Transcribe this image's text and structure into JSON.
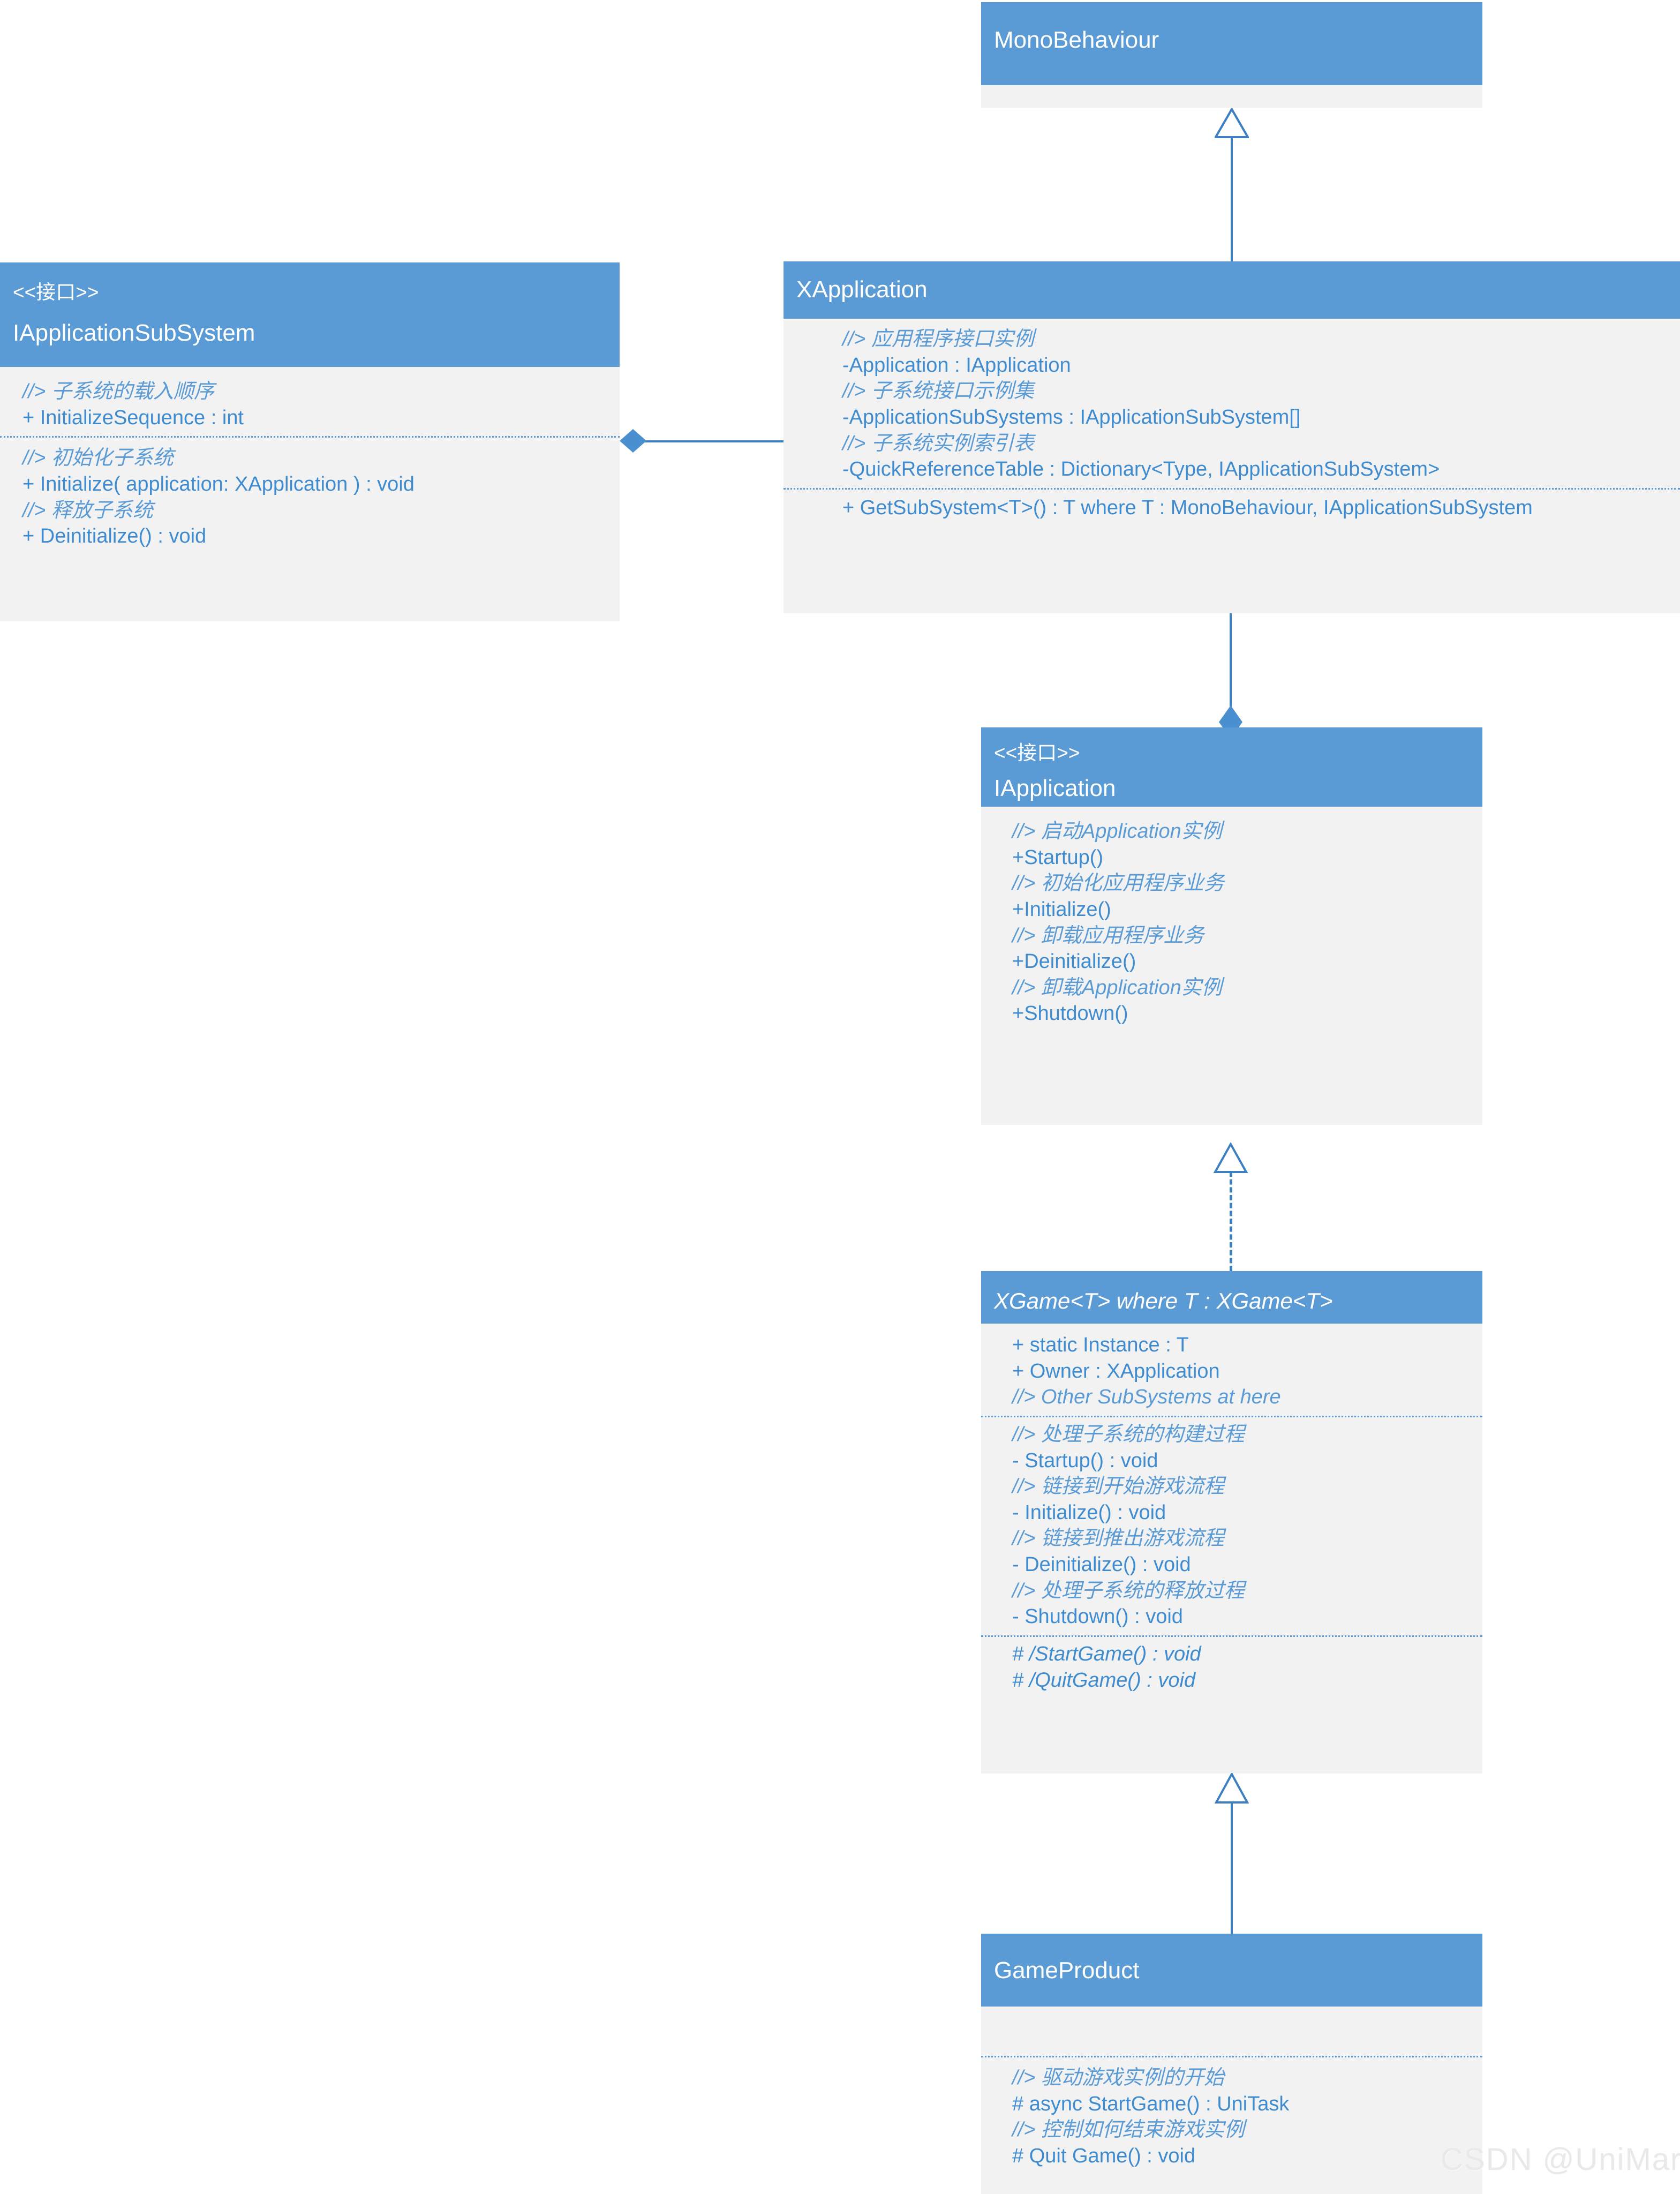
{
  "diagram": {
    "kind": "uml-class-diagram",
    "colors": {
      "header_fill": "#5b9bd5",
      "body_fill": "#f2f2f2",
      "member_text": "#3e8bd0",
      "connector": "#3e7fc1",
      "watermark": "#e9e9e9"
    }
  },
  "classes": {
    "monobehaviour": {
      "name": "MonoBehaviour",
      "stereotype": "",
      "compartments": []
    },
    "iapplicationsubsystem": {
      "stereotype": "<<接口>>",
      "name": "IApplicationSubSystem",
      "attributes": [
        "//> 子系统的载入顺序",
        "+ InitializeSequence : int"
      ],
      "operations": [
        "//> 初始化子系统",
        "+ Initialize( application: XApplication ) : void",
        "//> 释放子系统",
        "+ Deinitialize() : void"
      ]
    },
    "xapplication": {
      "stereotype": "",
      "name": "XApplication",
      "attributes": [
        "//> 应用程序接口实例",
        "-Application : IApplication",
        "//> 子系统接口示例集",
        "-ApplicationSubSystems : IApplicationSubSystem[]",
        "//> 子系统实例索引表",
        "-QuickReferenceTable : Dictionary<Type, IApplicationSubSystem>"
      ],
      "operations": [
        "+ GetSubSystem<T>() : T where T : MonoBehaviour, IApplicationSubSystem"
      ]
    },
    "iapplication": {
      "stereotype": "<<接口>>",
      "name": "IApplication",
      "operations": [
        "//> 启动Application实例",
        "+Startup()",
        "//> 初始化应用程序业务",
        "+Initialize()",
        "//> 卸载应用程序业务",
        "+Deinitialize()",
        "//> 卸载Application实例",
        "+Shutdown()"
      ]
    },
    "xgame": {
      "stereotype": "",
      "name": "XGame<T>  where T : XGame<T>",
      "attributes": [
        "+ static Instance : T",
        "+ Owner : XApplication",
        "//> Other SubSystems at here"
      ],
      "operations": [
        "//> 处理子系统的构建过程",
        "- Startup() : void",
        "//> 链接到开始游戏流程",
        "- Initialize() : void",
        "//> 链接到推出游戏流程",
        "- Deinitialize() : void",
        "//> 处理子系统的释放过程",
        "- Shutdown() : void"
      ],
      "abstract_operations": [
        "# /StartGame() : void",
        "# /QuitGame() : void"
      ]
    },
    "gameproduct": {
      "stereotype": "",
      "name": "GameProduct",
      "attributes": [],
      "operations": [
        "//> 驱动游戏实例的开始",
        "# async StartGame() : UniTask",
        "//> 控制如何结束游戏实例",
        "# Quit Game() : void"
      ]
    }
  },
  "relationships": [
    {
      "from": "XApplication",
      "to": "MonoBehaviour",
      "type": "generalization"
    },
    {
      "from": "XApplication",
      "to": "IApplicationSubSystem",
      "type": "aggregation"
    },
    {
      "from": "XApplication",
      "to": "IApplication",
      "type": "aggregation"
    },
    {
      "from": "XGame<T>",
      "to": "IApplication",
      "type": "realization"
    },
    {
      "from": "GameProduct",
      "to": "XGame<T>",
      "type": "generalization"
    }
  ],
  "watermark": "CSDN @UniMark"
}
